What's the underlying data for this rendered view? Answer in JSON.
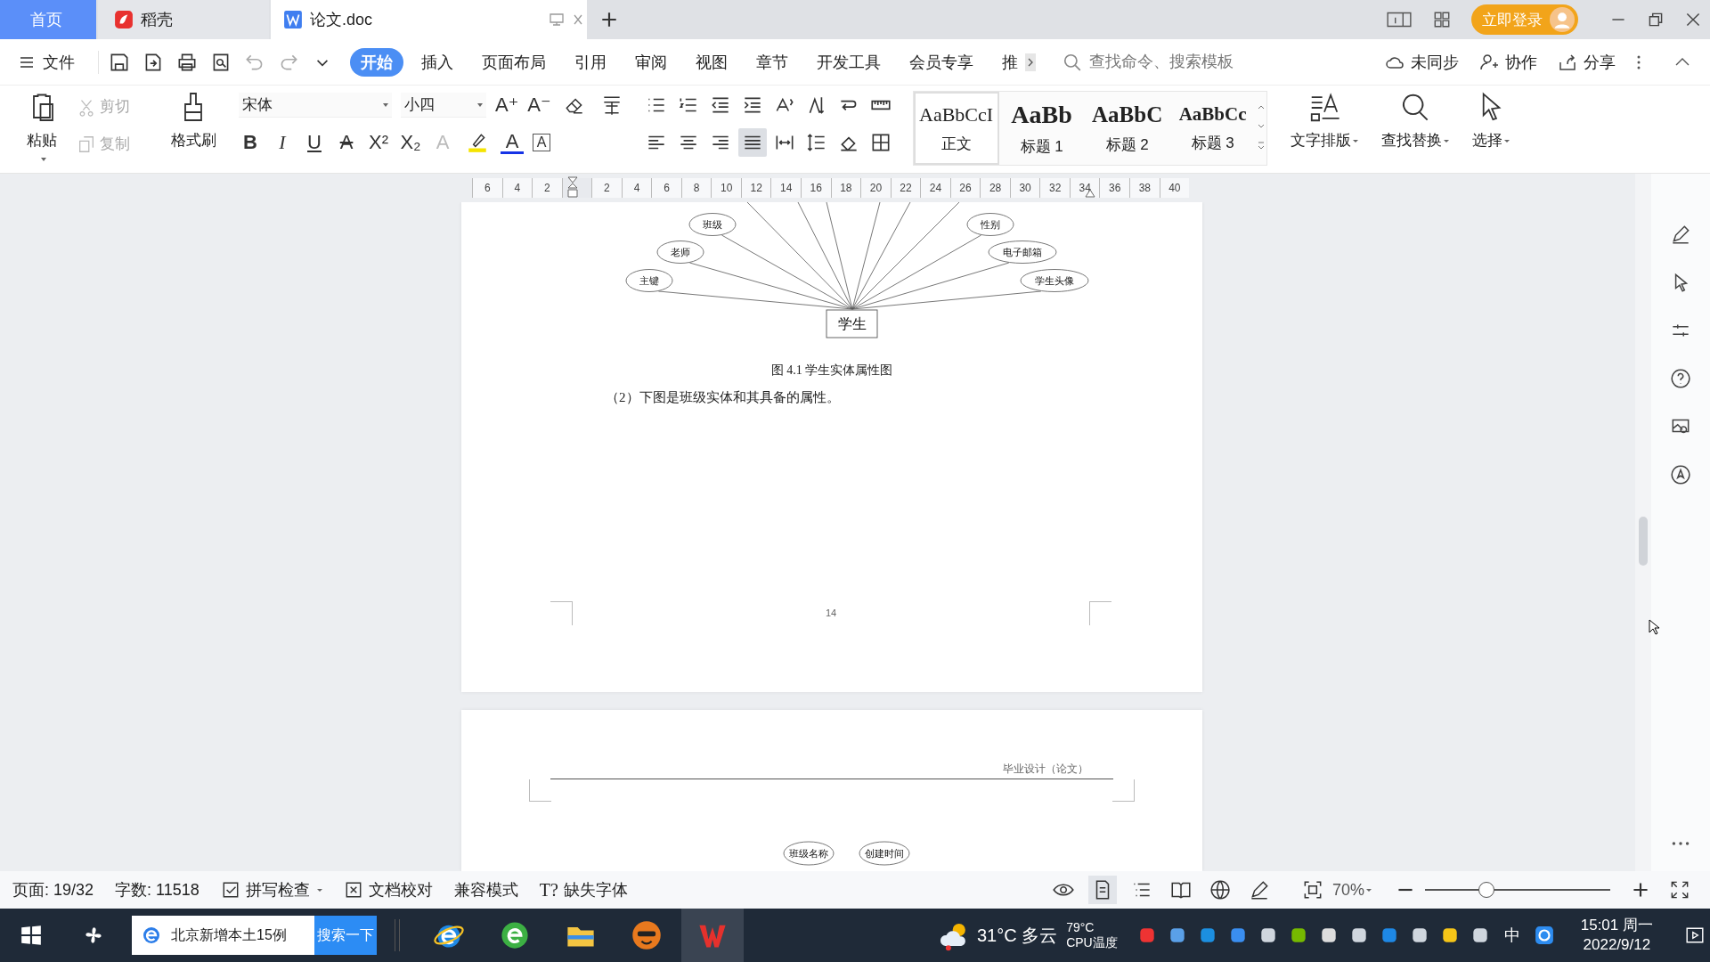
{
  "tabs": [
    {
      "kind": "home",
      "label": "首页",
      "selected": false
    },
    {
      "kind": "docer",
      "label": "稻壳",
      "selected": false
    },
    {
      "kind": "document",
      "label": "论文.doc",
      "selected": true
    }
  ],
  "login_button": "立即登录",
  "file_menu": "文件",
  "ribbon_tabs": [
    {
      "label": "开始",
      "selected": true
    },
    {
      "label": "插入",
      "selected": false
    },
    {
      "label": "页面布局",
      "selected": false
    },
    {
      "label": "引用",
      "selected": false
    },
    {
      "label": "审阅",
      "selected": false
    },
    {
      "label": "视图",
      "selected": false
    },
    {
      "label": "章节",
      "selected": false
    },
    {
      "label": "开发工具",
      "selected": false
    },
    {
      "label": "会员专享",
      "selected": false
    },
    {
      "label": "推",
      "selected": false
    }
  ],
  "command_search": {
    "placeholder": "查找命令、搜索模板"
  },
  "header_actions": [
    {
      "kind": "sync",
      "label": "未同步"
    },
    {
      "kind": "collab",
      "label": "协作"
    },
    {
      "kind": "share",
      "label": "分享"
    }
  ],
  "clipboard": [
    {
      "kind": "paste",
      "label": "粘贴",
      "disabled": false
    },
    {
      "kind": "cut",
      "label": "剪切",
      "disabled": true
    },
    {
      "kind": "copy",
      "label": "复制",
      "disabled": true
    },
    {
      "kind": "painter",
      "label": "格式刷",
      "disabled": false
    }
  ],
  "font": {
    "name": "宋体",
    "size": "小四"
  },
  "size_buttons": [
    "A⁺",
    "A⁻"
  ],
  "format_buttons": [
    {
      "kind": "bold",
      "label": "B"
    },
    {
      "kind": "italic",
      "label": "I"
    },
    {
      "kind": "underline",
      "label": "U"
    },
    {
      "kind": "strike",
      "label": "A"
    },
    {
      "kind": "sup",
      "label": "X²"
    },
    {
      "kind": "sub",
      "label": "X₂"
    },
    {
      "kind": "effect",
      "label": "A"
    },
    {
      "kind": "color",
      "label": "A"
    },
    {
      "kind": "boxed",
      "label": "A"
    }
  ],
  "align_buttons": [
    {
      "selected": false
    },
    {
      "selected": false
    },
    {
      "selected": false
    },
    {
      "selected": true
    },
    {
      "selected": false
    }
  ],
  "styles": [
    {
      "kind": "normal",
      "preview": "AaBbCcI",
      "label": "正文",
      "selected": true
    },
    {
      "kind": "h1",
      "preview": "AaBb",
      "label": "标题 1",
      "selected": false
    },
    {
      "kind": "h2",
      "preview": "AaBbC",
      "label": "标题 2",
      "selected": false
    },
    {
      "kind": "h3",
      "preview": "AaBbCc",
      "label": "标题 3",
      "selected": false
    }
  ],
  "tools": [
    {
      "kind": "layout",
      "label": "文字排版"
    },
    {
      "kind": "find",
      "label": "查找替换"
    },
    {
      "kind": "select",
      "label": "选择"
    }
  ],
  "ruler": [
    "6",
    "4",
    "2",
    "2",
    "4",
    "6",
    "8",
    "10",
    "12",
    "14",
    "16",
    "18",
    "20",
    "22",
    "24",
    "26",
    "28",
    "30",
    "32",
    "34",
    "36",
    "38",
    "40"
  ],
  "page_1": {
    "diagram": {
      "entity": "学生",
      "attributes": [
        "主键",
        "老师",
        "班级",
        "性别",
        "电子邮箱",
        "学生头像"
      ]
    },
    "caption": "图 4.1 学生实体属性图",
    "paragraph": "（2）下图是班级实体和其具备的属性。",
    "page_number": "14"
  },
  "page_2": {
    "header": "毕业设计（论文）",
    "attributes": [
      "班级名称",
      "创建时间"
    ]
  },
  "status_bar": {
    "page": "页面: 19/32",
    "words": "字数: 11518",
    "tools": [
      {
        "kind": "spell",
        "label": "拼写检查"
      },
      {
        "kind": "proof",
        "label": "文档校对"
      },
      {
        "kind": "compat",
        "label": "兼容模式"
      },
      {
        "kind": "font",
        "glyph": "T?",
        "label": "缺失字体"
      }
    ],
    "view_modes": [
      {
        "selected": true
      },
      {
        "selected": false
      },
      {
        "selected": false
      },
      {
        "selected": false
      },
      {
        "selected": false
      }
    ],
    "zoom": "70%",
    "zoom_slider": {
      "level": 0.33
    }
  },
  "taskbar": {
    "search_text": "北京新增本土15例",
    "search_button": "搜索一下",
    "apps": [
      {
        "kind": "ie",
        "selected": false
      },
      {
        "kind": "browser",
        "selected": false
      },
      {
        "kind": "folder",
        "selected": false
      },
      {
        "kind": "cat",
        "selected": false
      },
      {
        "kind": "wps",
        "selected": true
      }
    ],
    "weather": {
      "temperature": "31°C",
      "condition": "多云"
    },
    "cpu": {
      "temperature": "79°C",
      "label": "CPU温度"
    },
    "input_method": "中",
    "time": "15:01 周一",
    "date": "2022/9/12"
  }
}
